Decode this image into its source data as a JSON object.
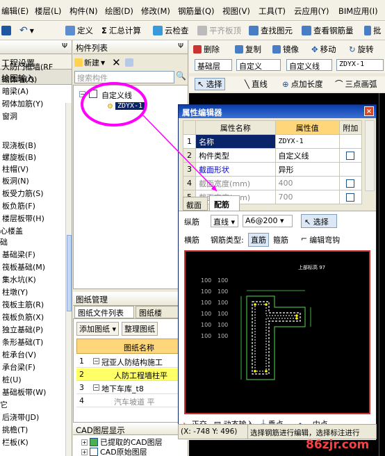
{
  "menubar": {
    "items": [
      "编辑(E)",
      "楼层(L)",
      "构件(N)",
      "绘图(D)",
      "修改(M)",
      "钢筋量(Q)",
      "视图(V)",
      "工具(T)",
      "云应用(Y)",
      "BIM应用(I)"
    ]
  },
  "toolbar": {
    "define": "定义",
    "sum_calc": "汇总计算",
    "cloud_check": "云检查",
    "flat_slab": "平齐板顶",
    "find_element": "查找图元",
    "view_rebar": "查看钢筋量",
    "batch": "批"
  },
  "left_panel": {
    "title": "工程设置",
    "section": "绘图输入",
    "pin": "Ψ",
    "items": [
      "人防门框墙(RF",
      "砌体墙(Q)",
      "暗梁(A)",
      "砌体加筋(Y)",
      "窗洞",
      "现浇板(B)",
      "螺旋板(B)",
      "柱帽(V)",
      "板洞(N)",
      "板受力筋(S)",
      "板负筋(F)",
      "楼层板带(H)",
      "心楼盖",
      "础",
      "基础梁(F)",
      "筏板基础(M)",
      "集水坑(K)",
      "柱墩(Y)",
      "筏板主筋(R)",
      "筏板负筋(X)",
      "独立基础(P)",
      "条形基础(T)",
      "桩承台(V)",
      "承台梁(F)",
      "桩(U)",
      "基础板带(W)",
      "它",
      "后浇带(JD)",
      "挑檐(T)",
      "栏板(K)"
    ]
  },
  "component_panel": {
    "title": "构件列表",
    "new_label": "新建",
    "search_placeholder": "搜索构件",
    "tree_root": "自定义线",
    "tree_child": "ZDYX-1"
  },
  "drawing_panel": {
    "title": "图纸管理",
    "tab_file_list": "图纸文件列表",
    "tab_drawing_floor": "图纸楼",
    "add_drawing": "添加图纸",
    "organize_drawing": "整理图纸",
    "col_header": "图纸名称",
    "rows": [
      {
        "num": "1",
        "name": "冠亚人防结构施工"
      },
      {
        "num": "2",
        "name": "人防工程墙柱平"
      },
      {
        "num": "3",
        "name": "地下车库_t8"
      },
      {
        "num": "4",
        "name": "汽车坡道 平"
      }
    ]
  },
  "cad_panel": {
    "title": "CAD图层显示",
    "layers": [
      "已提取的CAD图层",
      "CAD原始图层"
    ]
  },
  "right_toolbar": {
    "delete": "删除",
    "copy": "复制",
    "mirror": "镜像",
    "move": "移动",
    "rotate": "旋转",
    "floor": "基础层",
    "category": "自定义",
    "type": "自定义线",
    "element": "ZDYX-1",
    "select": "选择",
    "line": "直线",
    "point_length": "点加长度",
    "arc3": "三点画弧"
  },
  "property_editor": {
    "title": "属性编辑器",
    "close": "×",
    "headers": [
      "属性名称",
      "属性值",
      "附加"
    ],
    "rows": [
      {
        "num": "1",
        "name": "名称",
        "value": "ZDYX-1",
        "has_check": false
      },
      {
        "num": "2",
        "name": "构件类型",
        "value": "自定义线",
        "has_check": true
      },
      {
        "num": "3",
        "name": "截面形状",
        "value": "异形",
        "has_check": false
      },
      {
        "num": "4",
        "name": "截面宽度(mm)",
        "value": "400",
        "has_check": true
      },
      {
        "num": "5",
        "name": "截面高度(mm)",
        "value": "700",
        "has_check": true
      }
    ],
    "tab_section": "截面",
    "tab_rebar": "配筋",
    "longitudinal": "纵筋",
    "line": "直线",
    "spec": "A6@200",
    "select": "选择",
    "transverse": "横筋",
    "rebar_type_label": "钢筋类型:",
    "straight_bar": "直筋",
    "stirrup": "箍筋",
    "edit_hook": "编辑弯钩",
    "canvas_note": "上部标高 97",
    "grid_labels": [
      "100",
      "100",
      "100",
      "100",
      "100",
      "100",
      "100",
      "100",
      "100",
      "100",
      "100",
      "100"
    ],
    "snap_orth": "正交",
    "snap_dynamic": "动态输入",
    "snap_perp": "垂点",
    "snap_mid": "中点",
    "coords": "(X: -748 Y: 496)",
    "status": "选择钢筋进行编辑，选择标注进行"
  },
  "watermark": "86zjr.com",
  "colors": {
    "highlight": "#ff00ff",
    "accent": "#0a246a",
    "selected_row": "#ffff66"
  }
}
